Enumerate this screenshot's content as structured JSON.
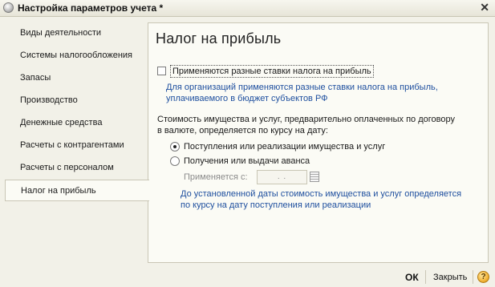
{
  "window": {
    "title": "Настройка параметров учета *",
    "close_icon": "close-icon",
    "app_icon": "app-logo-icon"
  },
  "sidebar": {
    "items": [
      {
        "label": "Виды деятельности",
        "active": false
      },
      {
        "label": "Системы налогообложения",
        "active": false
      },
      {
        "label": "Запасы",
        "active": false
      },
      {
        "label": "Производство",
        "active": false
      },
      {
        "label": "Денежные средства",
        "active": false
      },
      {
        "label": "Расчеты с контрагентами",
        "active": false
      },
      {
        "label": "Расчеты с персоналом",
        "active": false
      },
      {
        "label": "Налог на прибыль",
        "active": true
      }
    ]
  },
  "panel": {
    "title": "Налог на прибыль",
    "different_rates": {
      "label": "Применяются разные ставки налога на прибыль",
      "checked": false,
      "hint_line1": "Для организаций применяются разные ставки налога на прибыль,",
      "hint_line2": "уплачиваемого в бюджет субъектов РФ"
    },
    "valuation_text_line1": "Стоимость имущества и услуг, предварительно оплаченных по договору",
    "valuation_text_line2": "в валюте, определяется по курсу на дату:",
    "radio_options": [
      {
        "label": "Поступления или реализации имущества и услуг",
        "selected": true
      },
      {
        "label": "Получения или выдачи аванса",
        "selected": false
      }
    ],
    "applies_from": {
      "label": "Применяется с:",
      "value": ". .",
      "calendar_icon": "calendar-icon"
    },
    "date_hint_line1": "До установленной даты стоимость имущества и услуг определяется",
    "date_hint_line2": "по курсу на дату поступления или реализации"
  },
  "footer": {
    "ok_label": "ОК",
    "close_label": "Закрыть",
    "help_label": "?",
    "help_icon": "help-icon"
  },
  "colors": {
    "background": "#f2f1e8",
    "panel": "#fbfbf5",
    "hint_text": "#1d4e9e",
    "border": "#c9c6b5"
  }
}
